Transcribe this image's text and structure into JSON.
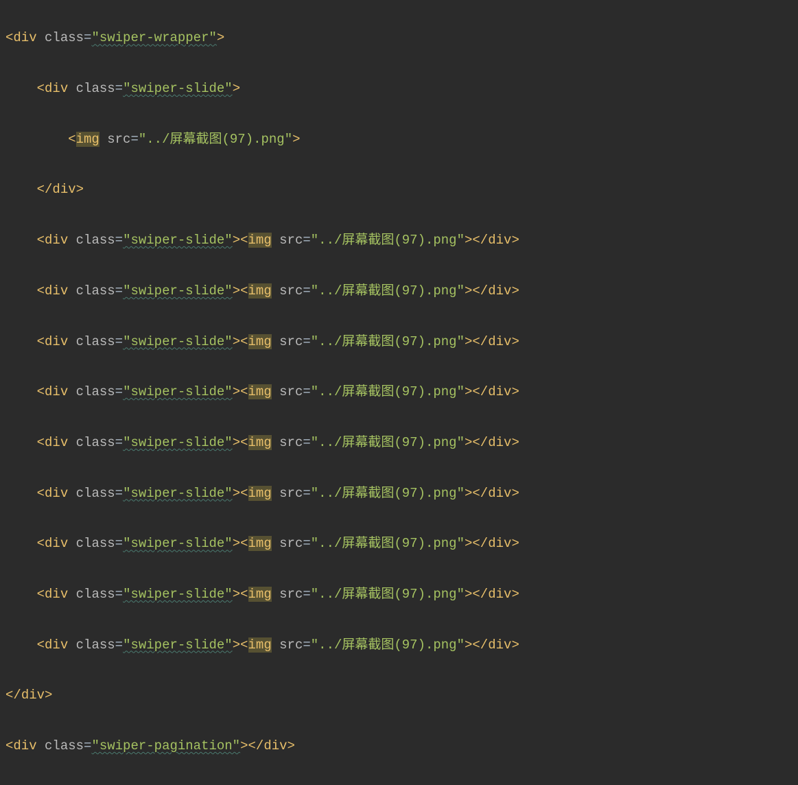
{
  "lines": {
    "l1": {
      "open": "<",
      "tag": "div",
      "sp": " ",
      "attr": "class",
      "eq": "=",
      "val": "\"swiper-wrapper\"",
      "close": ">"
    },
    "l2": {
      "indent": "    ",
      "open": "<",
      "tag": "div",
      "sp": " ",
      "attr": "class",
      "eq": "=",
      "val": "\"swiper-slide\"",
      "close": ">"
    },
    "l3": {
      "indent": "        ",
      "open": "<",
      "img": "img",
      "sp": " ",
      "attr": "src",
      "eq": "=",
      "val": "\"../屏幕截图(97).png\"",
      "close": ">"
    },
    "l4": {
      "indent": "    ",
      "open": "</",
      "tag": "div",
      "close": ">"
    },
    "slide": {
      "indent": "    ",
      "open1": "<",
      "tag1": "div",
      "sp1": " ",
      "attr1": "class",
      "eq1": "=",
      "val1": "\"swiper-slide\"",
      "close1": ">",
      "open2": "<",
      "img": "img",
      "sp2": " ",
      "attr2": "src",
      "eq2": "=",
      "val2": "\"../屏幕截图(97).png\"",
      "close2": ">",
      "open3": "</",
      "tag3": "div",
      "close3": ">"
    },
    "l14": {
      "open": "</",
      "tag": "div",
      "close": ">"
    },
    "l15": {
      "open1": "<",
      "tag1": "div",
      "sp": " ",
      "attr": "class",
      "eq": "=",
      "val": "\"swiper-pagination\"",
      "close1": ">",
      "open2": "</",
      "tag2": "div",
      "close2": ">"
    }
  },
  "classValues": {
    "swiperWrapper": "swiper-wrapper",
    "swiperSlide": "swiper-slide",
    "swiperPagination": "swiper-pagination"
  },
  "srcValue": "../屏幕截图(97).png",
  "repeatedSlideCount": 9
}
